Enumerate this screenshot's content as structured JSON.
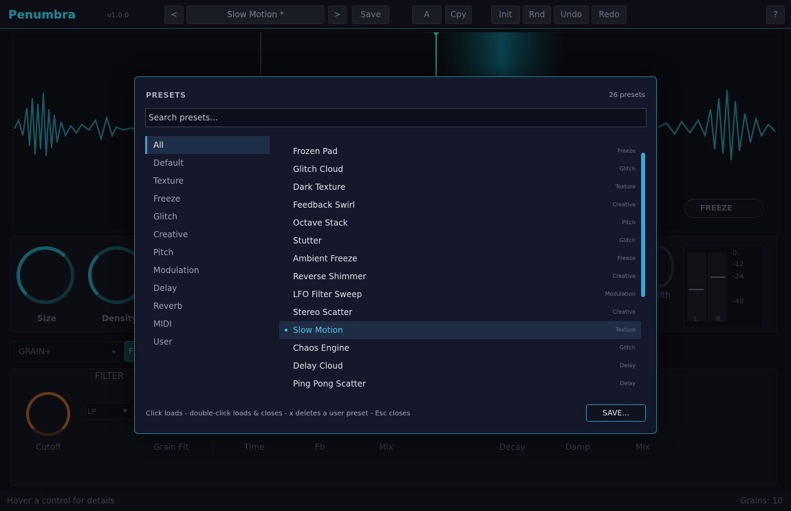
{
  "app": {
    "name": "Penumbra",
    "version": "v1.0.0"
  },
  "toolbar": {
    "prev_label": "<",
    "preset_name": "Slow Motion *",
    "next_label": ">",
    "save_label": "Save",
    "a_label": "A",
    "copy_label": "Cpy",
    "init_label": "Init",
    "random_label": "Rnd",
    "undo_label": "Undo",
    "redo_label": "Redo",
    "help_label": "?"
  },
  "background": {
    "freeze_label": "FREEZE",
    "knobs": {
      "size": "Size",
      "density": "Density",
      "width": "dth"
    },
    "meter": {
      "ticks": [
        "0",
        "-12",
        "-24",
        "-48"
      ],
      "left": "L",
      "right": "R"
    },
    "tabs": {
      "grain": "GRAIN+",
      "f": "F"
    },
    "filter": {
      "title": "FILTER",
      "type": "LP",
      "cutoff": "Cutoff"
    },
    "bottom_labels": [
      "Grain Flt",
      "Time",
      "Fb",
      "Mix",
      "Decay",
      "Damp",
      "Mix"
    ]
  },
  "status": {
    "hint": "Hover a control for details",
    "grains": "Grains: 10"
  },
  "presets_modal": {
    "title": "PRESETS",
    "count": "26 presets",
    "search_placeholder": "Search presets...",
    "categories": [
      {
        "label": "All",
        "active": true
      },
      {
        "label": "Default"
      },
      {
        "label": "Texture"
      },
      {
        "label": "Freeze"
      },
      {
        "label": "Glitch"
      },
      {
        "label": "Creative"
      },
      {
        "label": "Pitch"
      },
      {
        "label": "Modulation"
      },
      {
        "label": "Delay"
      },
      {
        "label": "Reverb"
      },
      {
        "label": "MIDI"
      },
      {
        "label": "User"
      }
    ],
    "presets": [
      {
        "name": "Frozen Pad",
        "category": "Freeze"
      },
      {
        "name": "Glitch Cloud",
        "category": "Glitch"
      },
      {
        "name": "Dark Texture",
        "category": "Texture"
      },
      {
        "name": "Feedback Swirl",
        "category": "Creative"
      },
      {
        "name": "Octave Stack",
        "category": "Pitch"
      },
      {
        "name": "Stutter",
        "category": "Glitch"
      },
      {
        "name": "Ambient Freeze",
        "category": "Freeze"
      },
      {
        "name": "Reverse Shimmer",
        "category": "Creative"
      },
      {
        "name": "LFO Filter Sweep",
        "category": "Modulation"
      },
      {
        "name": "Stereo Scatter",
        "category": "Creative"
      },
      {
        "name": "Slow Motion",
        "category": "Texture",
        "selected": true
      },
      {
        "name": "Chaos Engine",
        "category": "Glitch"
      },
      {
        "name": "Delay Cloud",
        "category": "Delay"
      },
      {
        "name": "Ping Pong Scatter",
        "category": "Delay"
      }
    ],
    "hint": "Click loads - double-click loads & closes - x deletes a user preset - Esc closes",
    "save_button": "SAVE..."
  },
  "colors": {
    "accent": "#2b7b8a",
    "selected_text": "#4cc2e6",
    "brand": "#1f8a94"
  }
}
